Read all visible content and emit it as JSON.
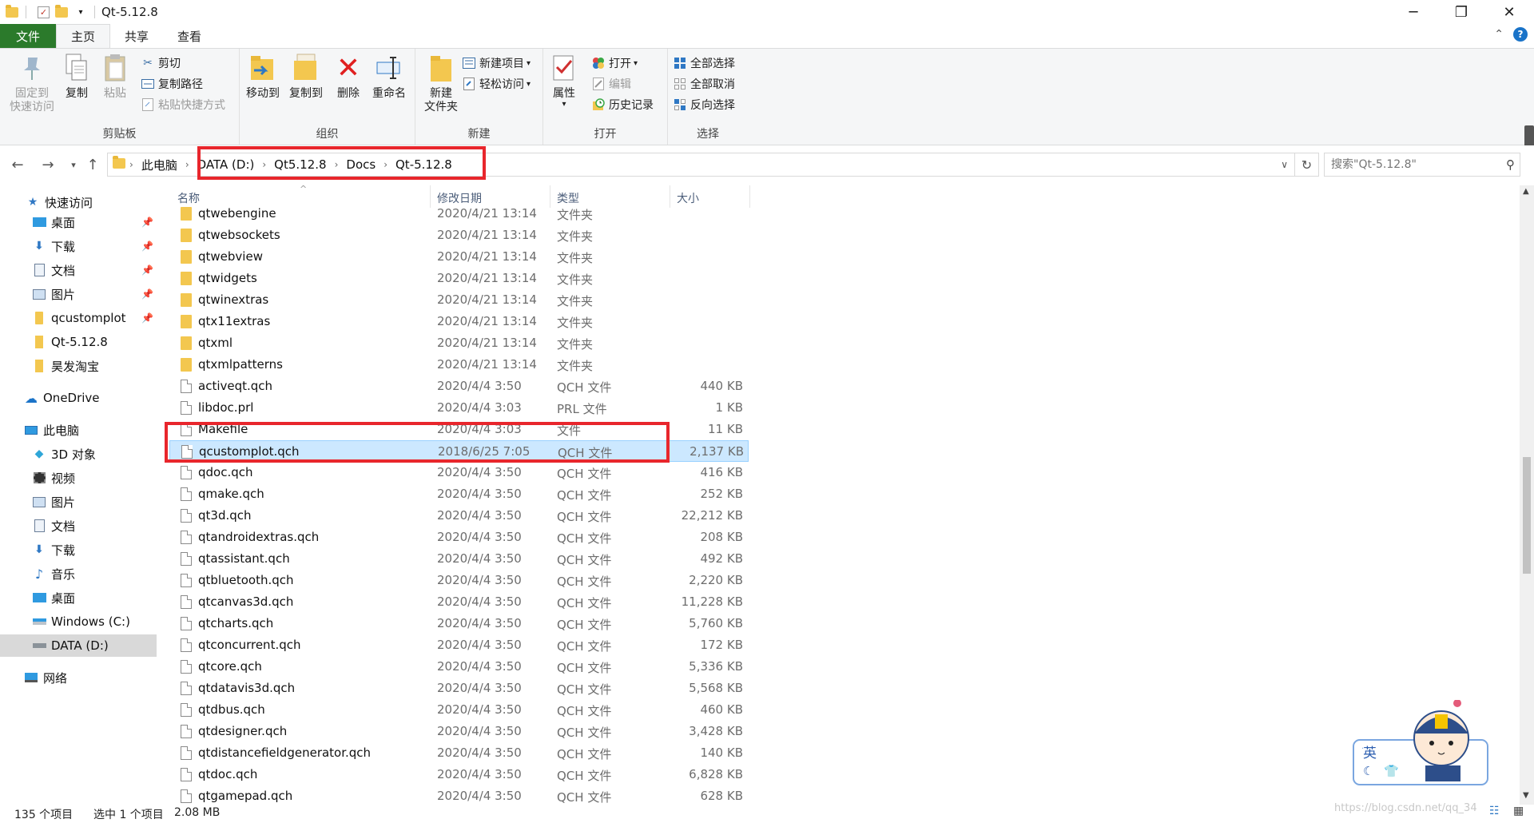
{
  "window": {
    "title": "Qt-5.12.8"
  },
  "tabs": {
    "file": "文件",
    "home": "主页",
    "share": "共享",
    "view": "查看"
  },
  "ribbon": {
    "clipboard": {
      "label": "剪贴板",
      "pin": "固定到\n快速访问",
      "copy": "复制",
      "paste": "粘贴",
      "cut": "剪切",
      "copy_path": "复制路径",
      "paste_shortcut": "粘贴快捷方式"
    },
    "organize": {
      "label": "组织",
      "move_to": "移动到",
      "copy_to": "复制到",
      "delete": "删除",
      "rename": "重命名"
    },
    "new": {
      "label": "新建",
      "new_folder": "新建\n文件夹",
      "new_item": "新建项目",
      "easy_access": "轻松访问"
    },
    "open": {
      "label": "打开",
      "properties": "属性",
      "open": "打开",
      "edit": "编辑",
      "history": "历史记录"
    },
    "select": {
      "label": "选择",
      "select_all": "全部选择",
      "select_none": "全部取消",
      "invert": "反向选择"
    }
  },
  "address": {
    "crumbs": [
      "此电脑",
      "DATA (D:)",
      "Qt5.12.8",
      "Docs",
      "Qt-5.12.8"
    ],
    "search_placeholder": "搜索\"Qt-5.12.8\""
  },
  "sidebar": {
    "quick_access": "快速访问",
    "quick_items": [
      "桌面",
      "下载",
      "文档",
      "图片",
      "qcustomplot",
      "Qt-5.12.8",
      "昊发淘宝"
    ],
    "onedrive": "OneDrive",
    "this_pc": "此电脑",
    "pc_items": [
      "3D 对象",
      "视频",
      "图片",
      "文档",
      "下载",
      "音乐",
      "桌面",
      "Windows (C:)",
      "DATA (D:)"
    ],
    "network": "网络"
  },
  "columns": {
    "name": "名称",
    "date": "修改日期",
    "type": "类型",
    "size": "大小"
  },
  "files": [
    {
      "name": "qtwebengine",
      "date": "2020/4/21 13:14",
      "type": "文件夹",
      "size": ""
    },
    {
      "name": "qtwebsockets",
      "date": "2020/4/21 13:14",
      "type": "文件夹",
      "size": ""
    },
    {
      "name": "qtwebview",
      "date": "2020/4/21 13:14",
      "type": "文件夹",
      "size": ""
    },
    {
      "name": "qtwidgets",
      "date": "2020/4/21 13:14",
      "type": "文件夹",
      "size": ""
    },
    {
      "name": "qtwinextras",
      "date": "2020/4/21 13:14",
      "type": "文件夹",
      "size": ""
    },
    {
      "name": "qtx11extras",
      "date": "2020/4/21 13:14",
      "type": "文件夹",
      "size": ""
    },
    {
      "name": "qtxml",
      "date": "2020/4/21 13:14",
      "type": "文件夹",
      "size": ""
    },
    {
      "name": "qtxmlpatterns",
      "date": "2020/4/21 13:14",
      "type": "文件夹",
      "size": ""
    },
    {
      "name": "activeqt.qch",
      "date": "2020/4/4 3:50",
      "type": "QCH 文件",
      "size": "440 KB"
    },
    {
      "name": "libdoc.prl",
      "date": "2020/4/4 3:03",
      "type": "PRL 文件",
      "size": "1 KB"
    },
    {
      "name": "Makefile",
      "date": "2020/4/4 3:03",
      "type": "文件",
      "size": "11 KB"
    },
    {
      "name": "qcustomplot.qch",
      "date": "2018/6/25 7:05",
      "type": "QCH 文件",
      "size": "2,137 KB"
    },
    {
      "name": "qdoc.qch",
      "date": "2020/4/4 3:50",
      "type": "QCH 文件",
      "size": "416 KB"
    },
    {
      "name": "qmake.qch",
      "date": "2020/4/4 3:50",
      "type": "QCH 文件",
      "size": "252 KB"
    },
    {
      "name": "qt3d.qch",
      "date": "2020/4/4 3:50",
      "type": "QCH 文件",
      "size": "22,212 KB"
    },
    {
      "name": "qtandroidextras.qch",
      "date": "2020/4/4 3:50",
      "type": "QCH 文件",
      "size": "208 KB"
    },
    {
      "name": "qtassistant.qch",
      "date": "2020/4/4 3:50",
      "type": "QCH 文件",
      "size": "492 KB"
    },
    {
      "name": "qtbluetooth.qch",
      "date": "2020/4/4 3:50",
      "type": "QCH 文件",
      "size": "2,220 KB"
    },
    {
      "name": "qtcanvas3d.qch",
      "date": "2020/4/4 3:50",
      "type": "QCH 文件",
      "size": "11,228 KB"
    },
    {
      "name": "qtcharts.qch",
      "date": "2020/4/4 3:50",
      "type": "QCH 文件",
      "size": "5,760 KB"
    },
    {
      "name": "qtconcurrent.qch",
      "date": "2020/4/4 3:50",
      "type": "QCH 文件",
      "size": "172 KB"
    },
    {
      "name": "qtcore.qch",
      "date": "2020/4/4 3:50",
      "type": "QCH 文件",
      "size": "5,336 KB"
    },
    {
      "name": "qtdatavis3d.qch",
      "date": "2020/4/4 3:50",
      "type": "QCH 文件",
      "size": "5,568 KB"
    },
    {
      "name": "qtdbus.qch",
      "date": "2020/4/4 3:50",
      "type": "QCH 文件",
      "size": "460 KB"
    },
    {
      "name": "qtdesigner.qch",
      "date": "2020/4/4 3:50",
      "type": "QCH 文件",
      "size": "3,428 KB"
    },
    {
      "name": "qtdistancefieldgenerator.qch",
      "date": "2020/4/4 3:50",
      "type": "QCH 文件",
      "size": "140 KB"
    },
    {
      "name": "qtdoc.qch",
      "date": "2020/4/4 3:50",
      "type": "QCH 文件",
      "size": "6,828 KB"
    },
    {
      "name": "qtgamepad.qch",
      "date": "2020/4/4 3:50",
      "type": "QCH 文件",
      "size": "628 KB"
    }
  ],
  "selected_file": "qcustomplot.qch",
  "status": {
    "count": "135 个项目",
    "selected": "选中 1 个项目",
    "size": "2.08 MB"
  },
  "overlay": {
    "ime_label": "英",
    "watermark": "https://blog.csdn.net/qq_34"
  }
}
